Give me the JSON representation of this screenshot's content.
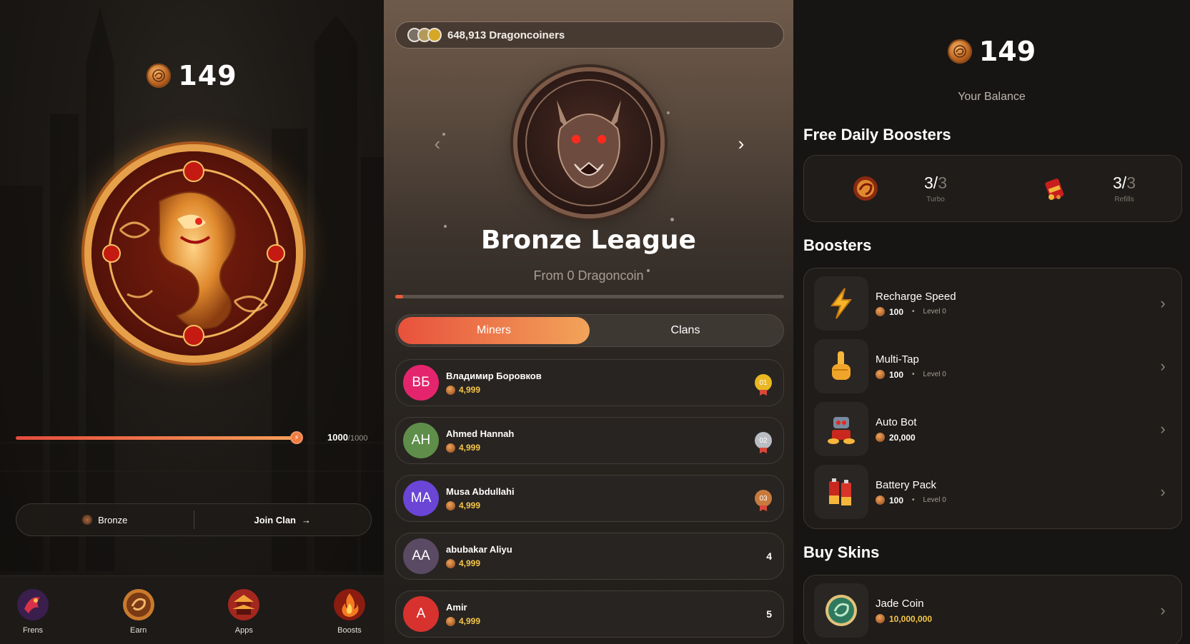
{
  "left": {
    "balance": "149",
    "energy": {
      "current": "1000",
      "max": "/1000",
      "fraction": 1.0
    },
    "league_label": "Bronze",
    "join_clan_label": "Join Clan",
    "join_clan_arrow": "→",
    "tabs": [
      {
        "label": "Frens",
        "icon": "dragon-fire-icon"
      },
      {
        "label": "Earn",
        "icon": "dragon-coin-icon"
      },
      {
        "label": "Apps",
        "icon": "pagoda-icon"
      },
      {
        "label": "Boosts",
        "icon": "flame-icon"
      }
    ]
  },
  "middle": {
    "counter_text": "648,913 Dragoncoiners",
    "league_title": "Bronze League",
    "league_subtitle": "From 0 Dragoncoin",
    "league_progress_fraction": 0.02,
    "tabs": [
      {
        "label": "Miners",
        "active": true
      },
      {
        "label": "Clans",
        "active": false
      }
    ],
    "leaders": [
      {
        "initials": "ВБ",
        "name": "Владимир Боровков",
        "score": "4,999",
        "rank": "01",
        "avatar_color": "#e4256d",
        "medal_color": "#e9b722"
      },
      {
        "initials": "AH",
        "name": "Ahmed Hannah",
        "score": "4,999",
        "rank": "02",
        "avatar_color": "#5e8e4a",
        "medal_color": "#b9bcc2"
      },
      {
        "initials": "MA",
        "name": "Musa Abdullahi",
        "score": "4,999",
        "rank": "03",
        "avatar_color": "#6a45d6",
        "medal_color": "#c77a3d"
      },
      {
        "initials": "AA",
        "name": "abubakar Aliyu",
        "score": "4,999",
        "rank": "4",
        "avatar_color": "#5a4a63",
        "medal_color": ""
      },
      {
        "initials": "A",
        "name": "Amir",
        "score": "4,999",
        "rank": "5",
        "avatar_color": "#d8322f",
        "medal_color": ""
      }
    ]
  },
  "right": {
    "balance": "149",
    "balance_label": "Your Balance",
    "daily_title": "Free Daily Boosters",
    "daily": [
      {
        "value": "3",
        "sep": "/",
        "total": "3",
        "label": "Turbo",
        "icon": "dragon-turbo-icon"
      },
      {
        "value": "3",
        "sep": "/",
        "total": "3",
        "label": "Refills",
        "icon": "refill-battery-icon"
      }
    ],
    "boosters_title": "Boosters",
    "boosters": [
      {
        "name": "Recharge Speed",
        "price": "100",
        "level": "Level 0",
        "icon": "lightning-icon"
      },
      {
        "name": "Multi-Tap",
        "price": "100",
        "level": "Level 0",
        "icon": "pointing-hand-icon"
      },
      {
        "name": "Auto Bot",
        "price": "20,000",
        "level": "",
        "icon": "robot-icon"
      },
      {
        "name": "Battery Pack",
        "price": "100",
        "level": "Level 0",
        "icon": "battery-icon"
      }
    ],
    "skins_title": "Buy Skins",
    "skins": [
      {
        "name": "Jade Coin",
        "price": "10,000,000",
        "icon": "jade-coin-icon"
      }
    ]
  }
}
